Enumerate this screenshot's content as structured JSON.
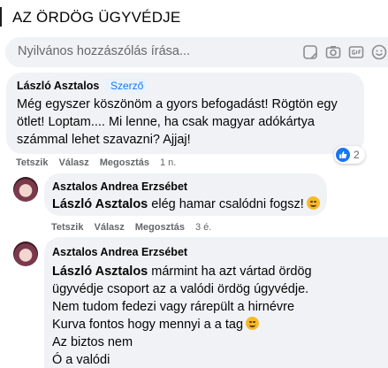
{
  "header": {
    "title": "AZ ÖRDÖG ÜGYVÉDJE"
  },
  "composer": {
    "placeholder": "Nyilvános hozzászólás írása...",
    "icons": [
      "sticker-icon",
      "camera-icon",
      "gif-icon",
      "emoji-icon"
    ]
  },
  "comments": [
    {
      "author": "László Asztalos",
      "badge": "Szerző",
      "text": "Még egyszer köszönöm a gyors befogadást! Rögtön egy ötlet! Loptam.... Mi lenne, ha csak magyar adókártya számmal lehet szavazni? Ajjaj!",
      "actions": {
        "like": "Tetszik",
        "reply": "Válasz",
        "share": "Megosztás",
        "time": "1 n."
      },
      "reactions": {
        "icon": "like-icon",
        "count": "2"
      }
    },
    {
      "author": "Asztalos Andrea Erzsébet",
      "mention": "László Asztalos",
      "text": " elég hamar csalódni fogsz!",
      "emoji": "smiling-face-emoji",
      "actions": {
        "like": "Tetszik",
        "reply": "Válasz",
        "share": "Megosztás",
        "time": "3 é."
      }
    },
    {
      "author": "Asztalos Andrea Erzsébet",
      "mention": "László Asztalos",
      "lines": [
        " mármint ha azt vártad ördög",
        "ügyvédje csoport az a valódi ördög úgyvédje.",
        "Nem tudom fedezi vagy rárepült a hirnévre",
        "Kurva fontos hogy mennyi a a tag",
        "Az biztos nem",
        "Ó a valódi"
      ],
      "emoji": "smiling-face-emoji"
    }
  ],
  "colors": {
    "bubble": "#f0f2f5",
    "accent": "#1877f2",
    "secondary_text": "#65676b"
  }
}
